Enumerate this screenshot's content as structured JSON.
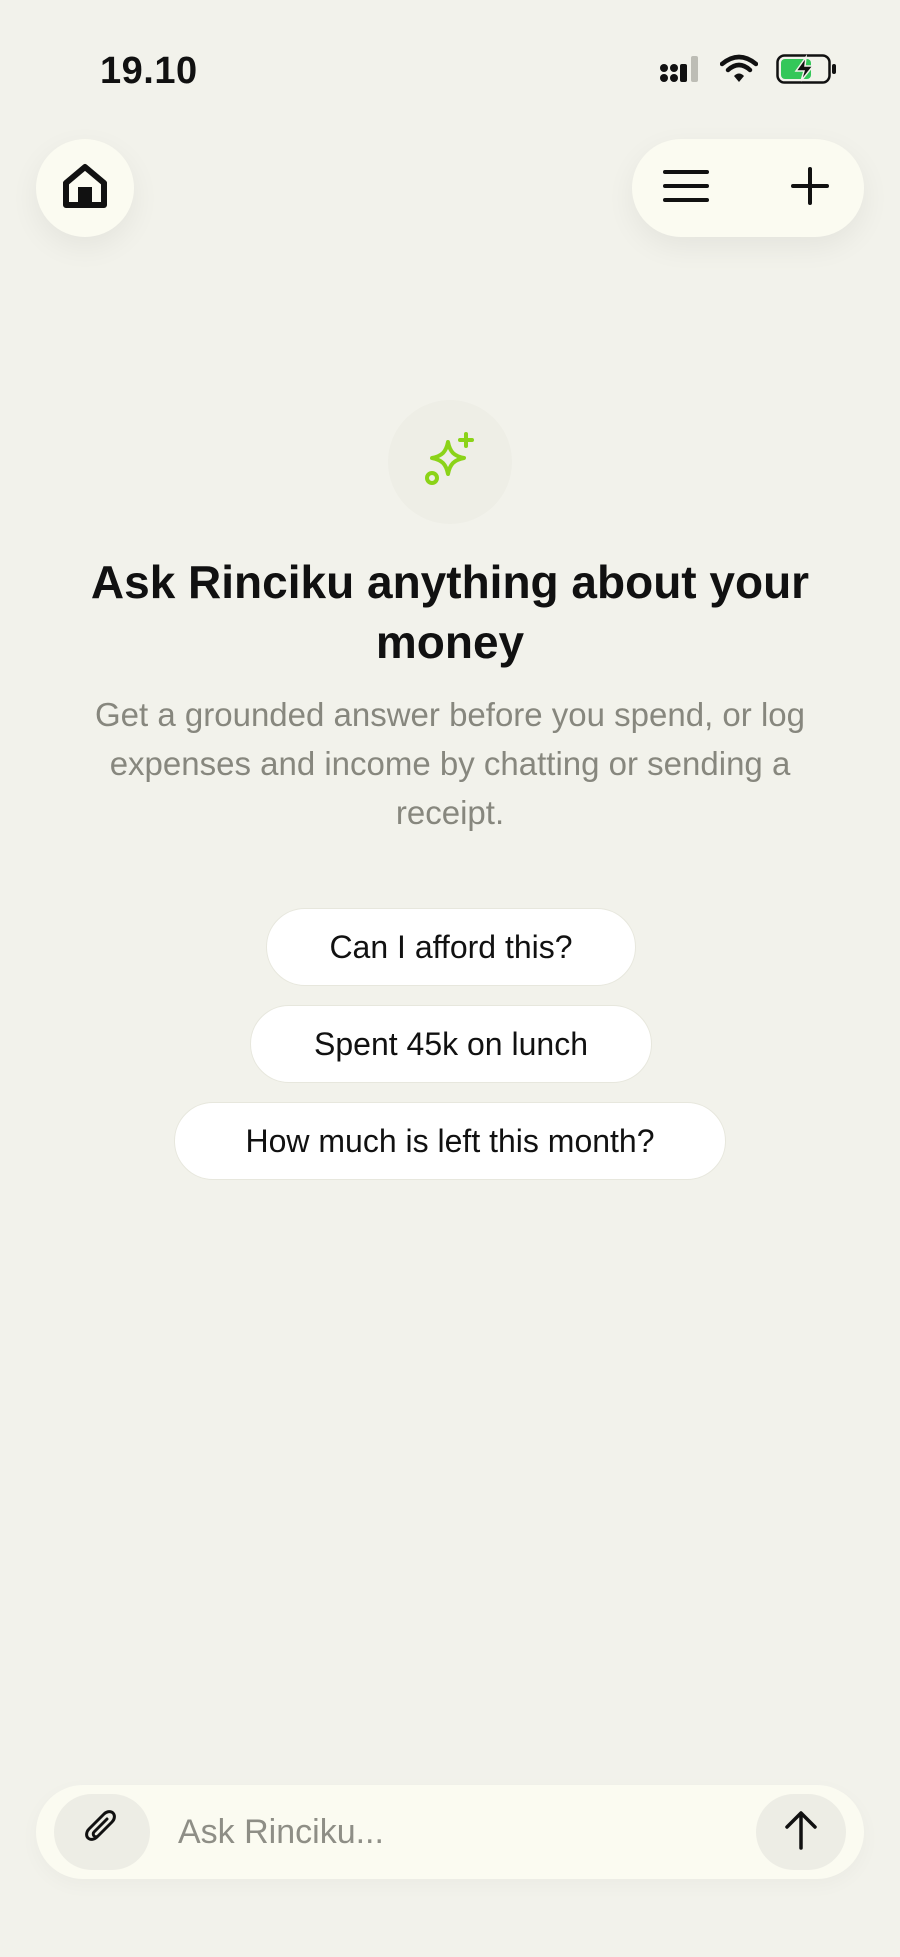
{
  "status_bar": {
    "time": "19.10",
    "signal_icon": "cellular-signal-icon",
    "wifi_icon": "wifi-icon",
    "battery_icon": "battery-charging-icon",
    "battery_color": "#34C759"
  },
  "header": {
    "home_icon": "home-icon",
    "menu_icon": "menu-icon",
    "new_chat_icon": "plus-icon"
  },
  "hero": {
    "icon": "sparkle-icon",
    "accent_color": "#8BD318",
    "title": "Ask Rinciku anything about your money",
    "subtitle": "Get a grounded answer before you spend, or log expenses and income by chatting or sending a receipt."
  },
  "suggestions": [
    {
      "label": "Can I afford this?"
    },
    {
      "label": "Spent 45k on lunch"
    },
    {
      "label": "How much is left this month?"
    }
  ],
  "composer": {
    "attach_icon": "paperclip-icon",
    "placeholder": "Ask Rinciku...",
    "value": "",
    "send_icon": "arrow-up-icon"
  }
}
